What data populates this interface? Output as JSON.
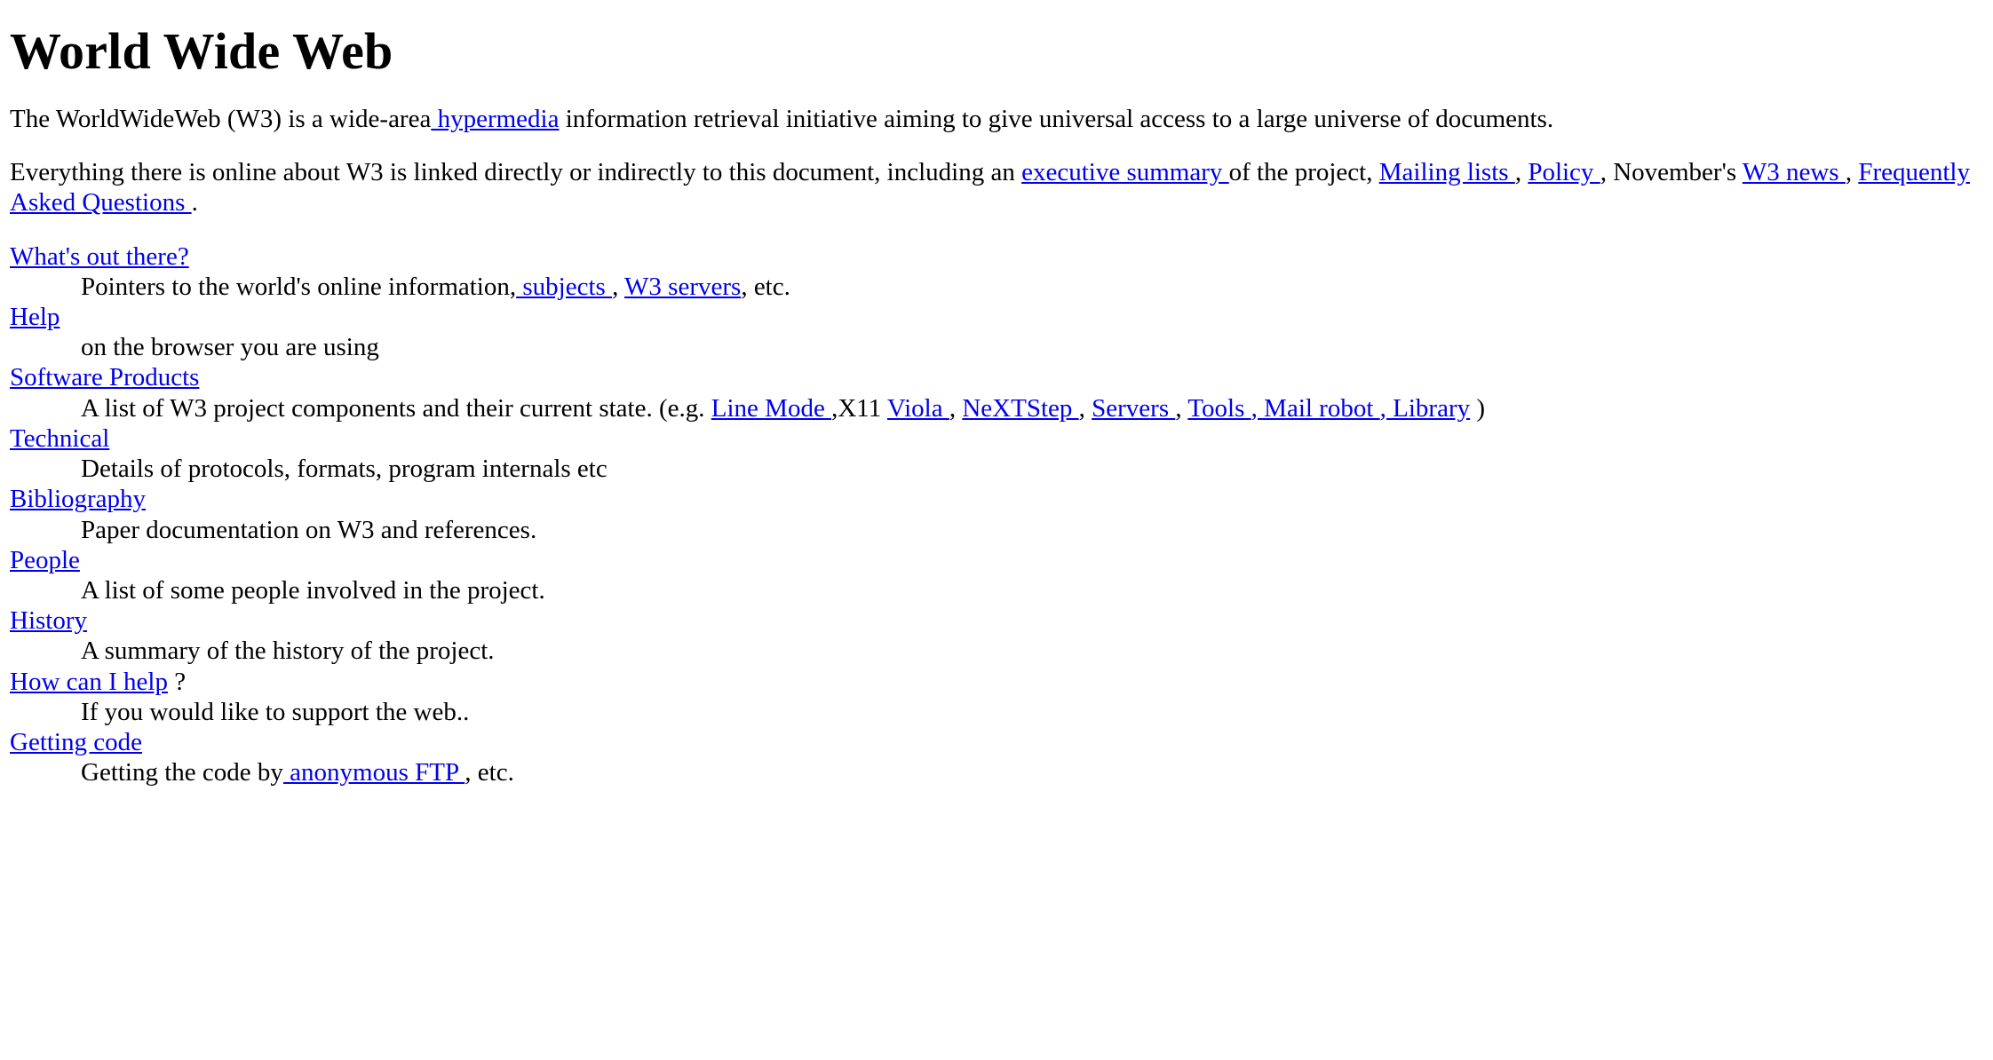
{
  "document": {
    "title": "World Wide Web",
    "link_color": "#0000ee",
    "text_color": "#000000",
    "background_color": "#ffffff"
  },
  "intro": {
    "para1": {
      "before_link": "The WorldWideWeb (W3) is a wide-area",
      "link": " hypermedia",
      "after_link": " information retrieval initiative aiming to give universal access to a large universe of documents."
    },
    "para2": {
      "segment1": "Everything there is online about W3 is linked directly or indirectly to this document, including an ",
      "link1": "executive summary ",
      "segment2": "of the project, ",
      "link2": "Mailing lists ",
      "segment3": ", ",
      "link3": "Policy ",
      "segment4": ", November's ",
      "link4": "W3 news ",
      "segment5": ", ",
      "link5": "Frequently Asked Questions ",
      "segment6": "."
    }
  },
  "sections": [
    {
      "term_link": "What's out there?",
      "term_suffix": "",
      "definition": {
        "text1": "Pointers to the world's online information,",
        "link1": " subjects ",
        "text2": ", ",
        "link2": "W3 servers",
        "text3": ", etc.",
        "link3": "",
        "text4": "",
        "link4": "",
        "text5": "",
        "link5": "",
        "text6": "",
        "link6": "",
        "text7": "",
        "link7": "",
        "text8": ""
      }
    },
    {
      "term_link": "Help",
      "term_suffix": "",
      "definition": {
        "text1": "on the browser you are using",
        "link1": "",
        "text2": "",
        "link2": "",
        "text3": "",
        "link3": "",
        "text4": "",
        "link4": "",
        "text5": "",
        "link5": "",
        "text6": "",
        "link6": "",
        "text7": "",
        "link7": "",
        "text8": ""
      }
    },
    {
      "term_link": "Software Products",
      "term_suffix": "",
      "definition": {
        "text1": "A list of W3 project components and their current state. (e.g. ",
        "link1": "Line Mode ",
        "text2": ",X11 ",
        "link2": "Viola ",
        "text3": ", ",
        "link3": "NeXTStep ",
        "text4": ", ",
        "link4": "Servers ",
        "text5": ", ",
        "link5": "Tools ",
        "text6": " ",
        "link6": ", Mail robot ",
        "text7": " ",
        "link7": ", Library",
        "text8": " )"
      }
    },
    {
      "term_link": "Technical",
      "term_suffix": "",
      "definition": {
        "text1": "Details of protocols, formats, program internals etc",
        "link1": "",
        "text2": "",
        "link2": "",
        "text3": "",
        "link3": "",
        "text4": "",
        "link4": "",
        "text5": "",
        "link5": "",
        "text6": "",
        "link6": "",
        "text7": "",
        "link7": "",
        "text8": ""
      }
    },
    {
      "term_link": "Bibliography",
      "term_suffix": "",
      "definition": {
        "text1": "Paper documentation on W3 and references.",
        "link1": "",
        "text2": "",
        "link2": "",
        "text3": "",
        "link3": "",
        "text4": "",
        "link4": "",
        "text5": "",
        "link5": "",
        "text6": "",
        "link6": "",
        "text7": "",
        "link7": "",
        "text8": ""
      }
    },
    {
      "term_link": "People",
      "term_suffix": "",
      "definition": {
        "text1": "A list of some people involved in the project.",
        "link1": "",
        "text2": "",
        "link2": "",
        "text3": "",
        "link3": "",
        "text4": "",
        "link4": "",
        "text5": "",
        "link5": "",
        "text6": "",
        "link6": "",
        "text7": "",
        "link7": "",
        "text8": ""
      }
    },
    {
      "term_link": "History",
      "term_suffix": "",
      "definition": {
        "text1": "A summary of the history of the project.",
        "link1": "",
        "text2": "",
        "link2": "",
        "text3": "",
        "link3": "",
        "text4": "",
        "link4": "",
        "text5": "",
        "link5": "",
        "text6": "",
        "link6": "",
        "text7": "",
        "link7": "",
        "text8": ""
      }
    },
    {
      "term_link": "How can I help",
      "term_suffix": " ?",
      "definition": {
        "text1": "If you would like to support the web..",
        "link1": "",
        "text2": "",
        "link2": "",
        "text3": "",
        "link3": "",
        "text4": "",
        "link4": "",
        "text5": "",
        "link5": "",
        "text6": "",
        "link6": "",
        "text7": "",
        "link7": "",
        "text8": ""
      }
    },
    {
      "term_link": "Getting code",
      "term_suffix": "",
      "definition": {
        "text1": "Getting the code by",
        "link1": " anonymous FTP ",
        "text2": ", etc.",
        "link2": "",
        "text3": "",
        "link3": "",
        "text4": "",
        "link4": "",
        "text5": "",
        "link5": "",
        "text6": "",
        "link6": "",
        "text7": "",
        "link7": "",
        "text8": ""
      }
    }
  ]
}
